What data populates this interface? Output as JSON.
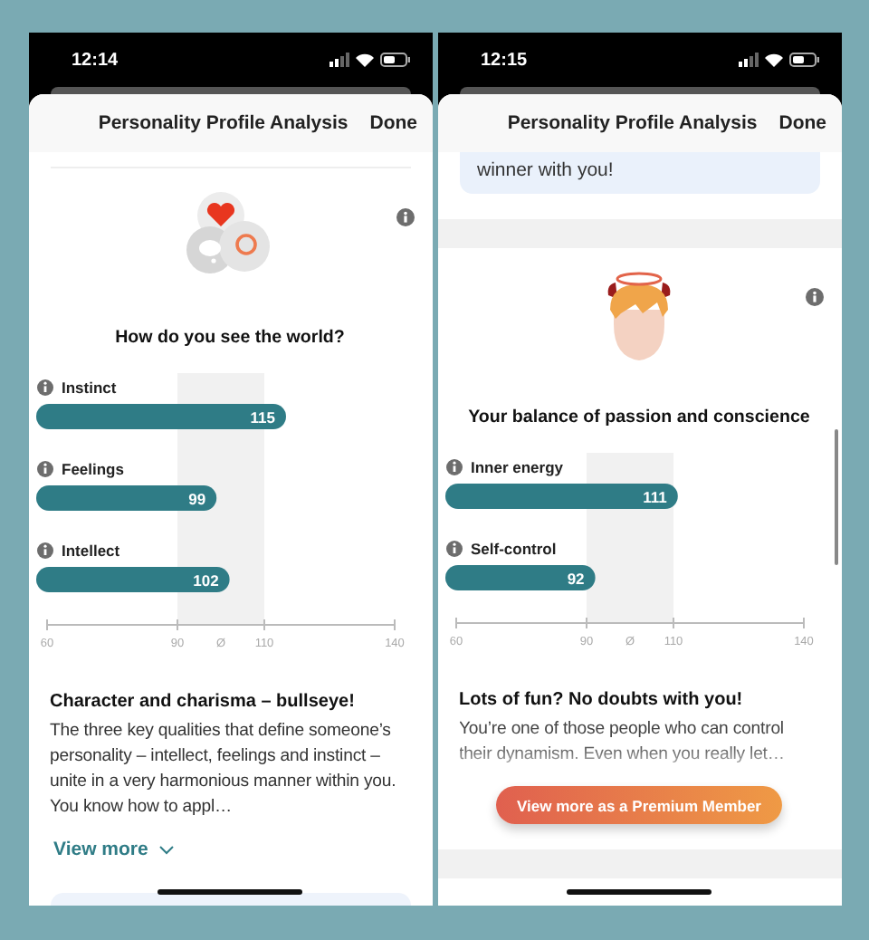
{
  "phones": [
    {
      "status_time": "12:14",
      "header": {
        "title": "Personality Profile Analysis",
        "done": "Done"
      },
      "sections": [
        {
          "kind": "divider"
        },
        {
          "kind": "bubbles_illustration"
        },
        {
          "kind": "title",
          "text": "How do you see the world?"
        },
        {
          "kind": "chart",
          "chart_data": {
            "type": "bar",
            "orientation": "horizontal",
            "categories": [
              "Instinct",
              "Feelings",
              "Intellect"
            ],
            "values": [
              115,
              99,
              102
            ],
            "xlim": [
              60,
              140
            ],
            "xticks": [
              60,
              90,
              {
                "value": 100,
                "label": "Ø"
              },
              110,
              140
            ],
            "data_labels": true,
            "bands": [
              {
                "axis": "x",
                "from": 90,
                "to": 110
              }
            ]
          }
        },
        {
          "kind": "heading",
          "text": "Character and charisma – bullseye!"
        },
        {
          "kind": "body",
          "text": "The three key qualities that define someone’s personality – intellect, feelings and instinct – unite in a very harmonious manner within you. You know how to appl…",
          "faded": false
        },
        {
          "kind": "view_more",
          "text": "View more"
        },
        {
          "kind": "card_stub"
        }
      ]
    },
    {
      "status_time": "12:15",
      "header": {
        "title": "Personality Profile Analysis",
        "done": "Done"
      },
      "scrollbar": true,
      "sections": [
        {
          "kind": "note_card",
          "text": "winner with you!"
        },
        {
          "kind": "band"
        },
        {
          "kind": "head_illustration"
        },
        {
          "kind": "title",
          "text": "Your balance of passion and conscience"
        },
        {
          "kind": "chart",
          "chart_data": {
            "type": "bar",
            "orientation": "horizontal",
            "categories": [
              "Inner energy",
              "Self-control"
            ],
            "values": [
              111,
              92
            ],
            "xlim": [
              60,
              140
            ],
            "xticks": [
              60,
              90,
              {
                "value": 100,
                "label": "Ø"
              },
              110,
              140
            ],
            "data_labels": true,
            "bands": [
              {
                "axis": "x",
                "from": 90,
                "to": 110
              }
            ]
          }
        },
        {
          "kind": "heading",
          "text": "Lots of fun? No doubts with you!"
        },
        {
          "kind": "body",
          "text": "You’re one of those people who can control their dynamism. Even when you really let…",
          "faded": true
        },
        {
          "kind": "premium_button",
          "text": "View more as a Premium Member"
        },
        {
          "kind": "band"
        }
      ]
    }
  ]
}
